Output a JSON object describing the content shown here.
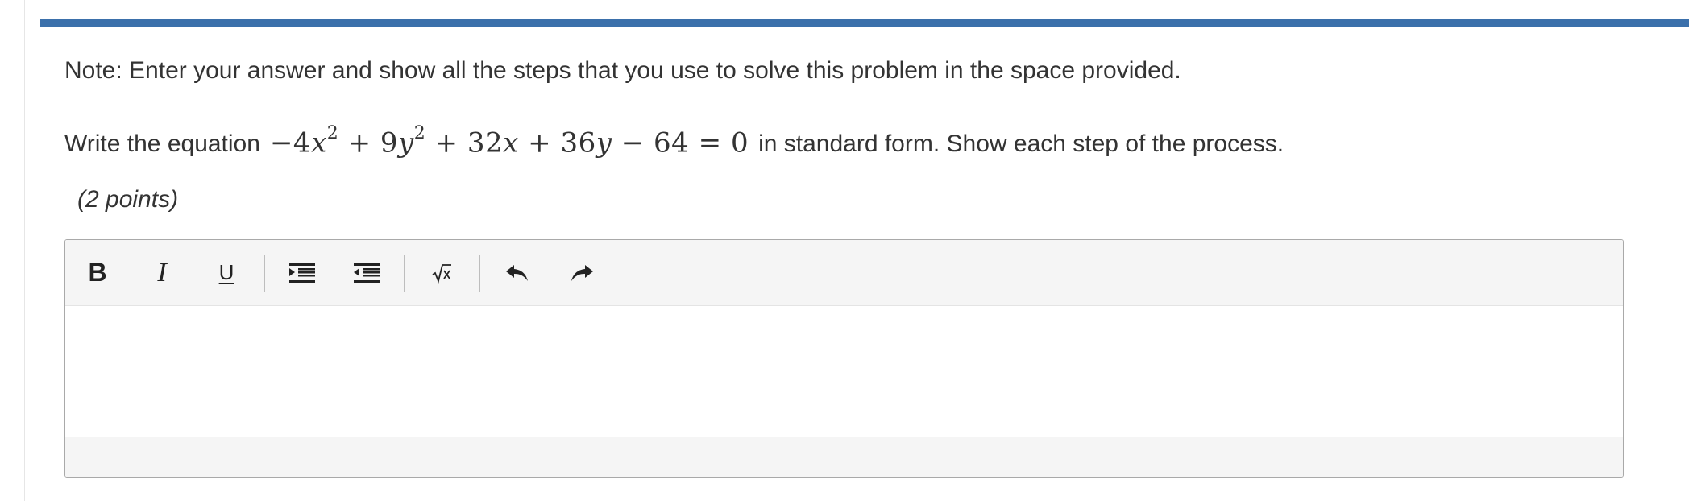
{
  "instructions": {
    "note": "Note: Enter your answer and show all the steps that you use to solve this problem in the space provided."
  },
  "question": {
    "prefix": "Write the equation",
    "suffix": "in standard form. Show each step of the process.",
    "equation": {
      "t1_coef": "−4",
      "t1_var": "x",
      "t1_exp": "2",
      "op1": "+",
      "t2_coef": "9",
      "t2_var": "y",
      "t2_exp": "2",
      "op2": "+",
      "t3_coef": "32",
      "t3_var": "x",
      "op3": "+",
      "t4_coef": "36",
      "t4_var": "y",
      "op4": "−",
      "t5": "64",
      "eq": "=",
      "rhs": "0"
    },
    "points": "(2 points)"
  },
  "toolbar": {
    "bold_label": "B",
    "italic_label": "I",
    "underline_label": "U",
    "indent_icon": "indent-icon",
    "outdent_icon": "outdent-icon",
    "formula_icon": "square-root-icon",
    "undo_icon": "undo-icon",
    "redo_icon": "redo-icon"
  },
  "colors": {
    "accent_bar": "#3b70ab",
    "toolbar_bg": "#f5f5f5",
    "border": "#a9a9a9"
  }
}
